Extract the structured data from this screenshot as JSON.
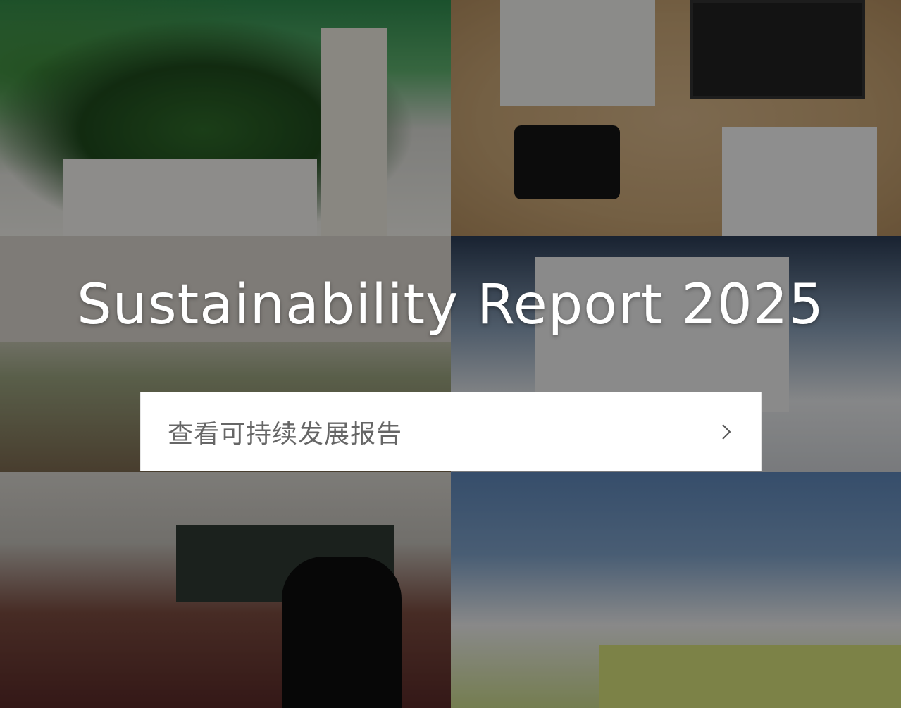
{
  "hero": {
    "title": "Sustainability Report 2025"
  },
  "cta": {
    "label": "查看可持续发展报告",
    "icon": "chevron-right-icon"
  },
  "photos": [
    {
      "name": "biodiversity-exhibit-photo"
    },
    {
      "name": "headphones-camera-exhibit-photo"
    },
    {
      "name": "school-visit-photo"
    },
    {
      "name": "exhibition-hall-photo"
    },
    {
      "name": "classroom-photo"
    },
    {
      "name": "students-activity-photo"
    }
  ],
  "colors": {
    "title_text": "#ffffff",
    "cta_background": "#ffffff",
    "cta_text": "#666666",
    "overlay": "rgba(0,0,0,0.42)"
  }
}
